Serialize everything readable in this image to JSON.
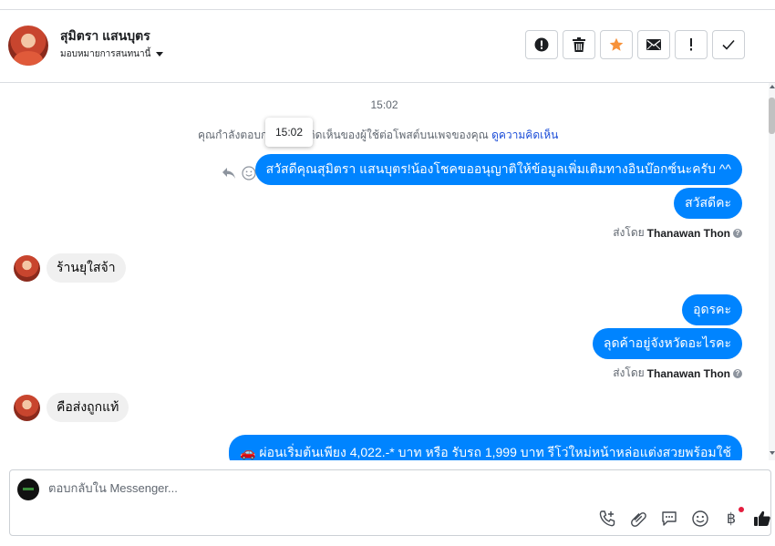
{
  "header": {
    "contact_name": "สุมิตรา แสนบุตร",
    "assign_label": "มอบหมายการสนทนานี้"
  },
  "toolbar": [
    {
      "name": "mark-spam-button",
      "icon": "alert-circle-icon"
    },
    {
      "name": "delete-button",
      "icon": "trash-icon"
    },
    {
      "name": "star-button",
      "icon": "star-icon",
      "color": "#f7923a"
    },
    {
      "name": "mark-unread-button",
      "icon": "envelope-icon"
    },
    {
      "name": "follow-up-button",
      "icon": "exclamation-icon"
    },
    {
      "name": "mark-done-button",
      "icon": "checkmark-icon"
    }
  ],
  "chat": {
    "timestamp": "15:02",
    "tooltip": "15:02",
    "reply_note_before": "คุณกำลังตอบกลับความคิดเห็นของผู้ใช้ต่อโพสต์บนเพจของคุณ ",
    "reply_note_link": "ดูความคิดเห็น",
    "messages": [
      {
        "dir": "out",
        "text": "สวัสดีคุณสุมิตรา แสนบุตร!น้องโชคขออนุญาติให้ข้อมูลเพิ่มเติมทางอินบ๊อกซ์นะครับ ^^"
      },
      {
        "dir": "out",
        "text": "สวัสดีคะ"
      },
      {
        "dir": "sent-by",
        "prefix": "ส่งโดย",
        "agent": "Thanawan Thon"
      },
      {
        "dir": "in",
        "text": "ร้านยุใสจ้า"
      },
      {
        "dir": "out",
        "text": "อุดรคะ"
      },
      {
        "dir": "out",
        "text": "ลุดค้าอยู่จังหวัดอะไรคะ"
      },
      {
        "dir": "sent-by",
        "prefix": "ส่งโดย",
        "agent": "Thanawan Thon"
      },
      {
        "dir": "in",
        "text": "คือส่งถูกแท้"
      },
      {
        "dir": "out",
        "text": "🚗 ผ่อนเริ่มต้นเพียง 4,022.-* บาท หรือ รับรถ 1,999 บาท รีโว่ใหม่หน้าหล่อแต่งสวยพร้อมใช้"
      }
    ]
  },
  "composer": {
    "placeholder": "ตอบกลับใน Messenger...",
    "tools": [
      "phone-plus-icon",
      "paperclip-icon",
      "chat-bubble-icon",
      "emoji-icon",
      "baht-currency-icon",
      "thumbs-up-icon"
    ],
    "currency_glyph": "฿"
  },
  "colors": {
    "outgoing_bubble": "#0084ff",
    "incoming_bubble": "#f0f0f0",
    "link": "#1d4ed8"
  }
}
